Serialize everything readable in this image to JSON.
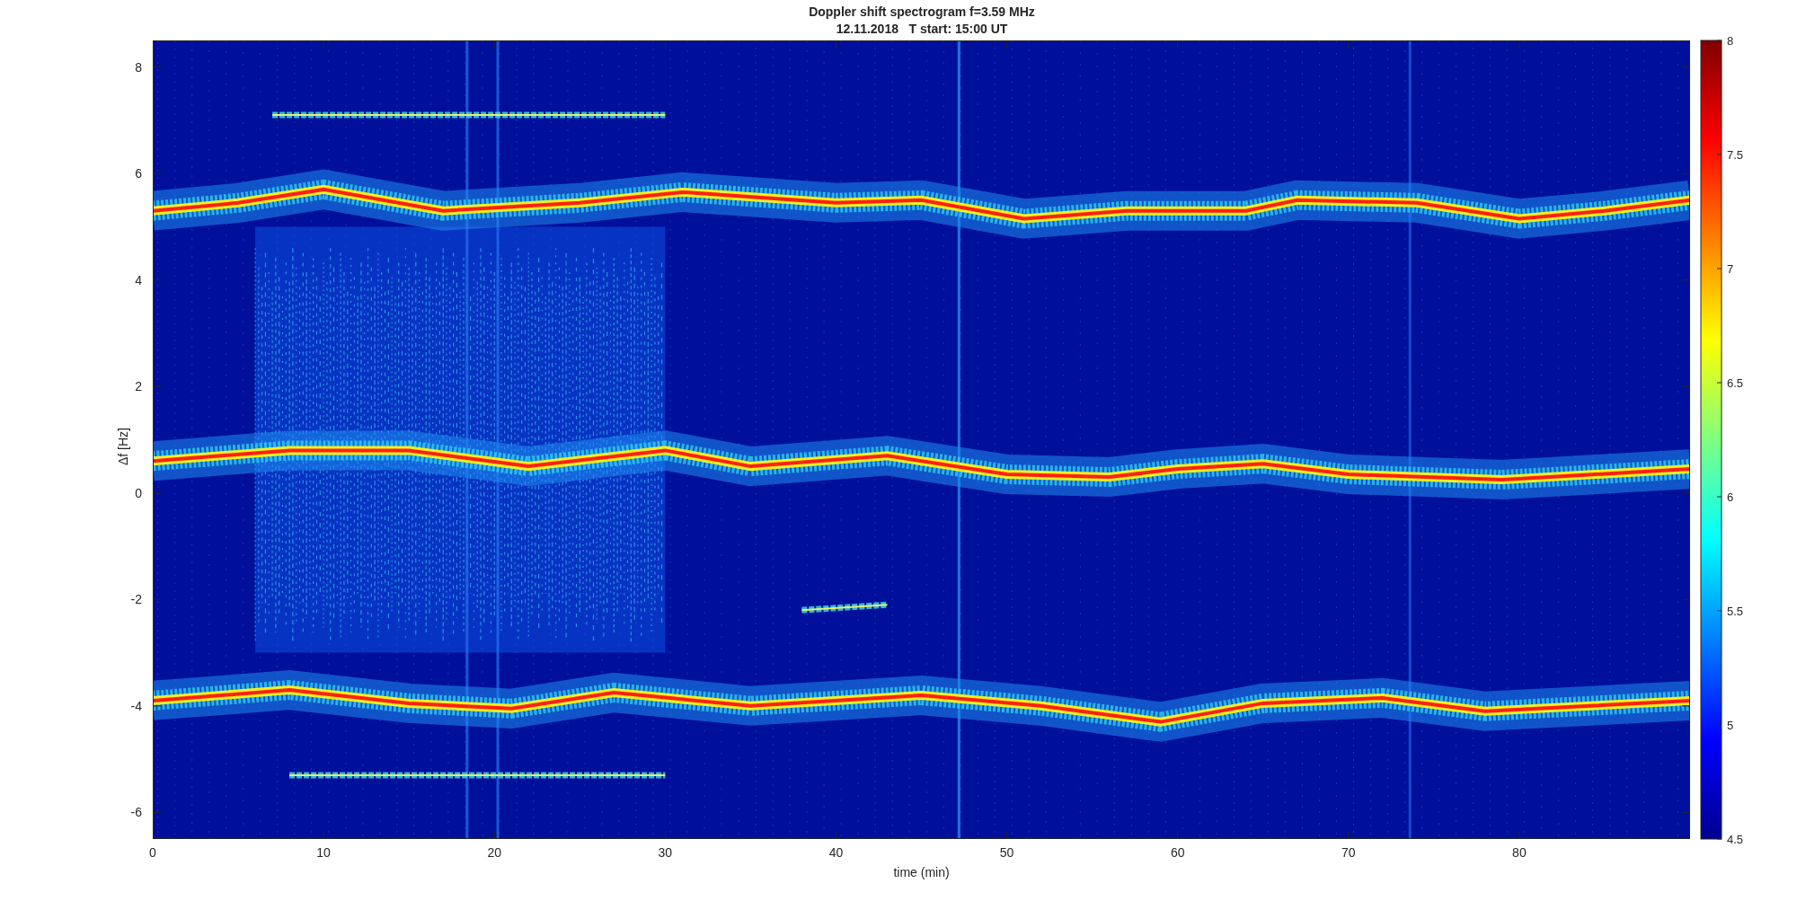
{
  "figure": {
    "title": "Doppler shift spectrogram f=3.59 MHz",
    "subtitle": "12.11.2018   T start: 15:00 UT",
    "ylabel": "Δf [Hz]",
    "xlabel": "time (min)",
    "yticks": [
      "8",
      "6",
      "4",
      "2",
      "0",
      "-2",
      "-4",
      "-6"
    ],
    "xticks": [
      "0",
      "10",
      "20",
      "30",
      "40",
      "50",
      "60",
      "70",
      "80"
    ],
    "colorbar_ticks": [
      "8",
      "7.5",
      "7",
      "6.5",
      "6",
      "5.5",
      "5",
      "4.5"
    ]
  }
}
